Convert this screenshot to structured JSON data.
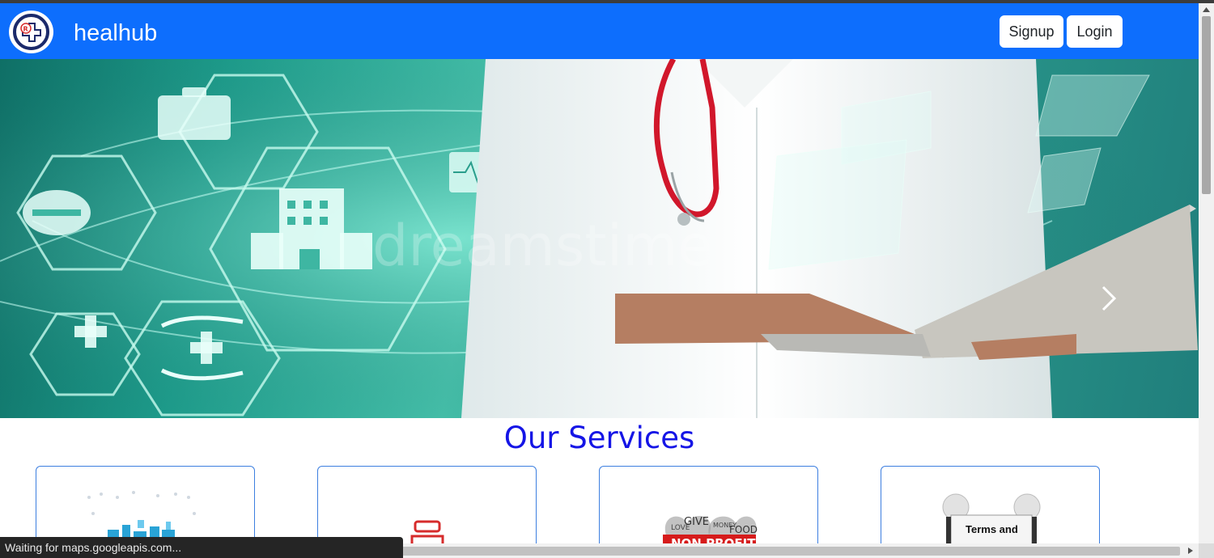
{
  "navbar": {
    "brand": "healhub",
    "logo_icon": "rx-plus-logo-icon",
    "signup_label": "Signup",
    "login_label": "Login",
    "colors": {
      "navbar_bg": "#0d6efd",
      "button_bg": "#ffffff"
    }
  },
  "hero": {
    "image": "doctor-with-laptop-and-medical-icons",
    "watermark_text": "dreamstime",
    "next_icon": "chevron-right-icon"
  },
  "services": {
    "title": "Our Services",
    "title_color": "#1515e6",
    "cards": [
      {
        "image": "pharmacy-shelves-icon"
      },
      {
        "image": "medicine-bottle-icon"
      },
      {
        "image": "non-profit-word-cloud",
        "caption": "NON PROFIT",
        "words": [
          "GIVE",
          "LOVE",
          "MONEY",
          "FOOD"
        ]
      },
      {
        "image": "terms-and-conditions-figures",
        "caption": "Terms and"
      }
    ]
  },
  "status_bar": {
    "text": "Waiting for maps.googleapis.com..."
  }
}
